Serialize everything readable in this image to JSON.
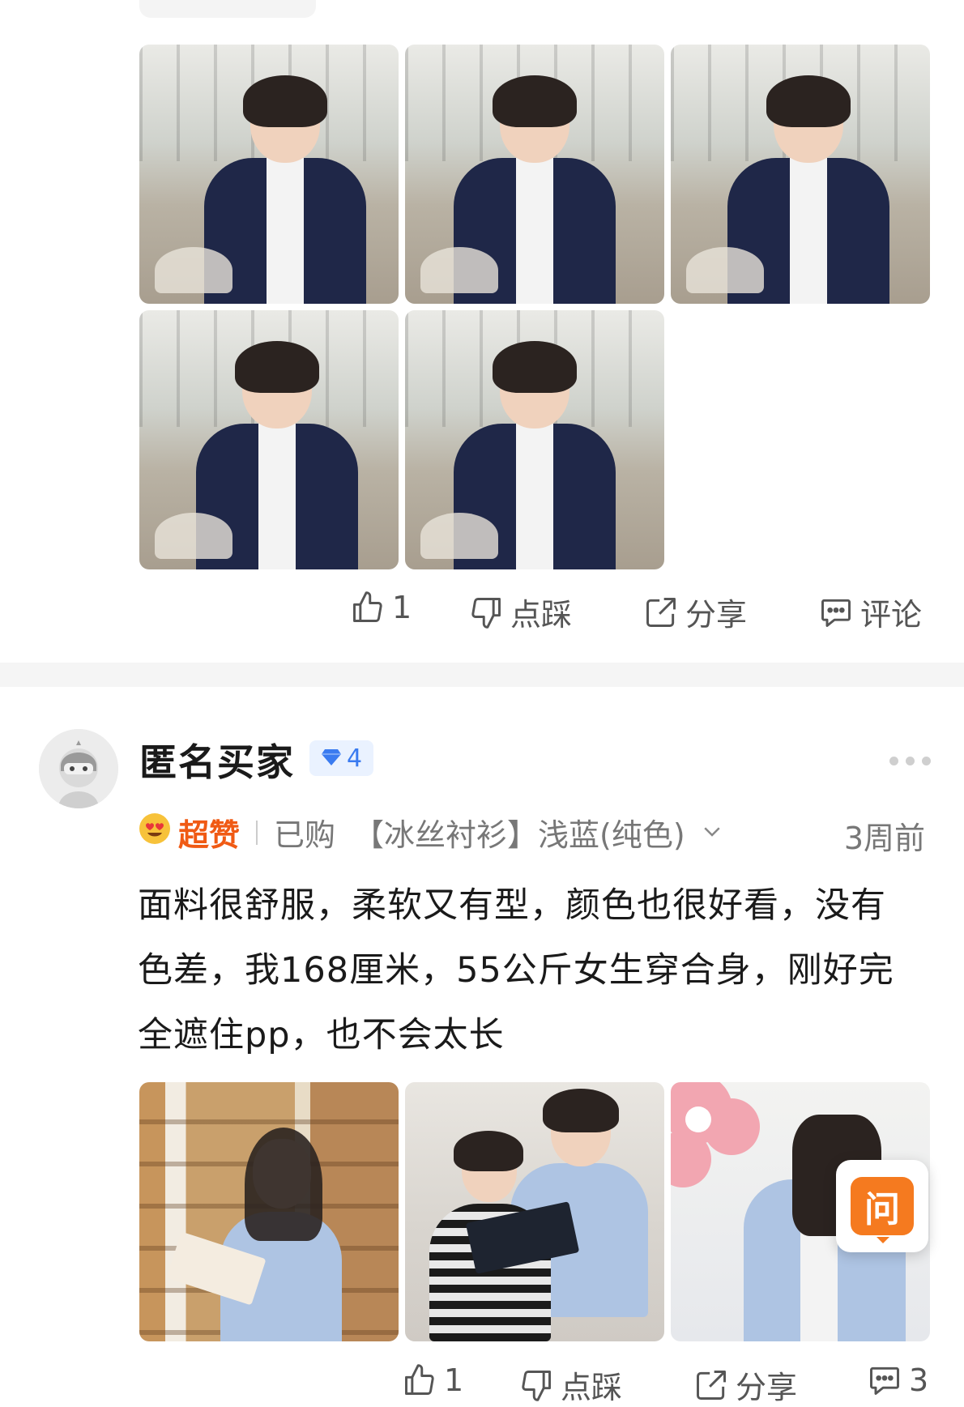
{
  "post1": {
    "actions": {
      "like_count": "1",
      "dislike_label": "点踩",
      "share_label": "分享",
      "comment_label": "评论"
    }
  },
  "post2": {
    "user": {
      "name": "匿名买家",
      "level": "4",
      "level_icon": "diamond-icon",
      "avatar_icon": "anonymous-avatar"
    },
    "rating": {
      "emoji": "heart-eyes-emoji",
      "label": "超赞"
    },
    "purchased": "已购",
    "variant": "【冰丝衬衫】浅蓝(纯色)",
    "time": "3周前",
    "review_text": "面料很舒服，柔软又有型，颜色也很好看，没有色差，我168厘米，55公斤女生穿合身，刚好完全遮住pp，也不会太长",
    "actions": {
      "like_count": "1",
      "dislike_label": "点踩",
      "share_label": "分享",
      "comment_count": "3"
    },
    "ask_button": "问"
  },
  "colors": {
    "accent_orange": "#f57a1f",
    "super_red": "#f05a14",
    "badge_blue": "#3a7bf0",
    "shirt_navy": "#1f2748",
    "shirt_light_blue": "#aec4e3"
  }
}
